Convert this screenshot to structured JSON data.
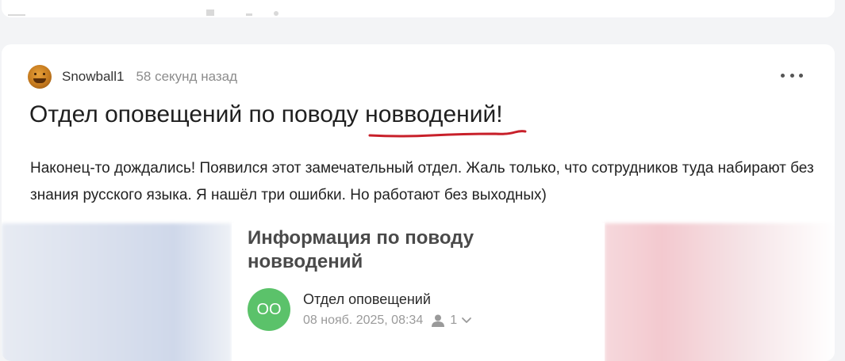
{
  "post": {
    "author": "Snowball1",
    "time": "58 секунд назад",
    "title": "Отдел оповещений по поводу новводений!",
    "body": "Наконец-то дождались! Появился этот замечательный отдел. Жаль только, что сотрудников туда набирают без знания русского языка. Я нашёл три ошибки. Но работают без выходных)"
  },
  "embed": {
    "title": "Информация по поводу новводений",
    "avatar_initials": "ОО",
    "department": "Отдел оповещений",
    "date": "08 нояб. 2025, 08:34",
    "count": "1"
  },
  "icons": {
    "more": "more-horizontal-icon",
    "person": "person-icon",
    "chevron": "chevron-down-icon"
  },
  "colors": {
    "underline": "#c8202a",
    "department_avatar": "#5bc26a"
  }
}
